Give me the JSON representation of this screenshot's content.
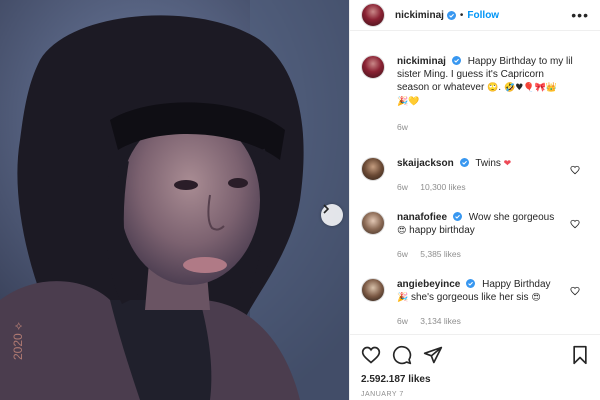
{
  "post": {
    "photo_alt": "selfie photo",
    "photo_watermark": "2020 ⟡"
  },
  "header": {
    "username": "nickiminaj",
    "dot": "•",
    "follow_label": "Follow",
    "more_label": "•••"
  },
  "caption": {
    "username": "nickiminaj",
    "text": "Happy Birthday to my lil sister Ming. I guess it's Capricorn season or whatever",
    "emojis": "🙄. 🤣♥🎈🎀👑",
    "emojis2": "🎉💛",
    "time": "6w"
  },
  "comments": [
    {
      "username": "skaijackson",
      "text": "Twins",
      "emoji": "❤",
      "time": "6w",
      "likes": "10,300 likes"
    },
    {
      "username": "nanafofiee",
      "text": "Wow she gorgeous",
      "text2": "happy birthday",
      "emoji": "😍",
      "time": "6w",
      "likes": "5,385 likes"
    },
    {
      "username": "angiebeyince",
      "text": "Happy Birthday",
      "text2": "she's gorgeous like her sis",
      "emoji_lead": "🎉",
      "emoji": "😍",
      "time": "6w",
      "likes": "3,134 likes"
    }
  ],
  "footer": {
    "likes": "2.592.187 likes",
    "date": "JANUARY 7"
  },
  "colors": {
    "accent": "#0095f6",
    "verified": "#3897f0",
    "heart_red": "#ed4956",
    "muted": "#8e8e8e"
  }
}
